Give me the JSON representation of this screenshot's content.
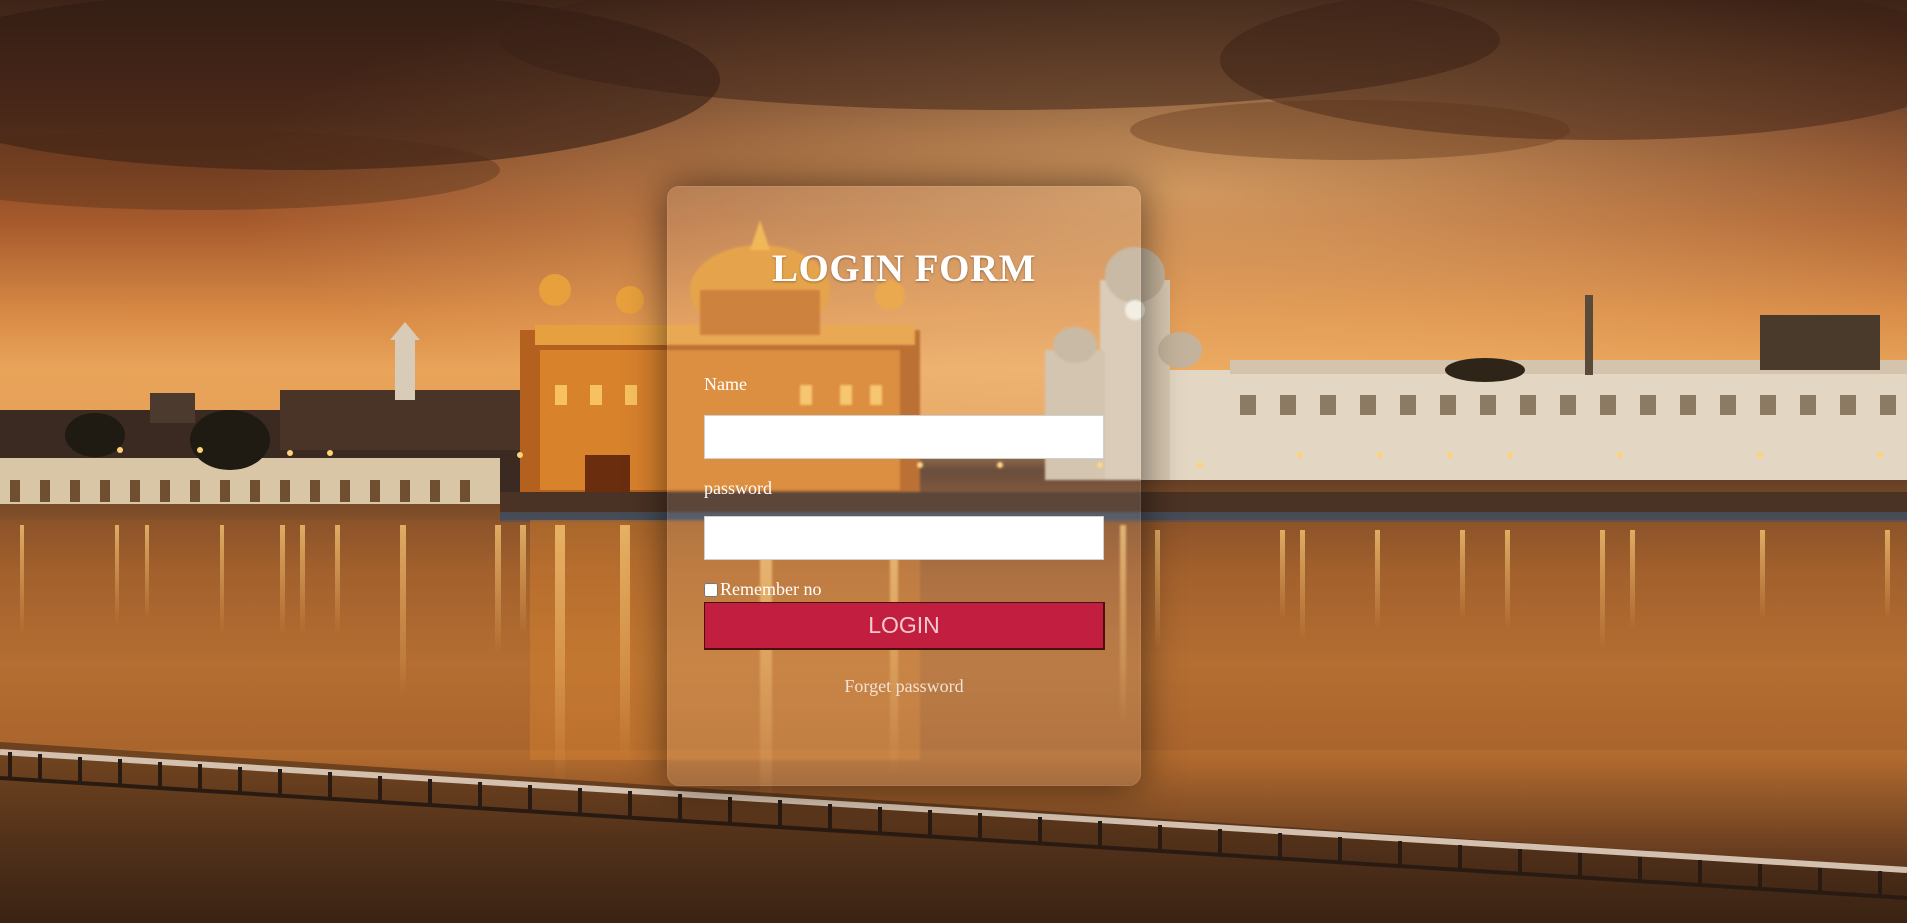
{
  "login_form": {
    "title": "LOGIN FORM",
    "name_label": "Name",
    "name_value": "",
    "password_label": "password",
    "password_value": "",
    "remember_label": "Remember no",
    "remember_checked": false,
    "login_button_label": "LOGIN",
    "forget_password_link": "Forget password"
  },
  "colors": {
    "button": "#c21e3f",
    "sky": "#e9a45a",
    "card_overlay": "rgba(255,255,255,0.10)"
  }
}
